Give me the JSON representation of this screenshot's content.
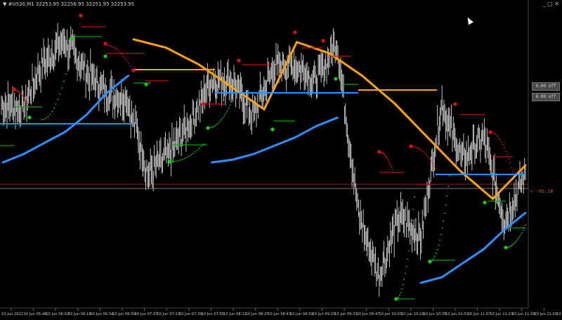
{
  "header": {
    "arrow": "▼",
    "symbol": "#US30,M1",
    "ohlc": "32253.95 32256.95 32251.95 32253.95",
    "window_controls": "_ □ ✕"
  },
  "badges": {
    "top": "0.00 off",
    "bottom": "0.00 off"
  },
  "countdown": "<--00:28",
  "colors": {
    "background": "#000000",
    "candles": "#d8d8d8",
    "ma_blue": "#2f8fff",
    "ma_orange": "#ffa20a",
    "sar_red": "#e01010",
    "sar_green": "#10d010",
    "level_red": "#c01010",
    "level_green": "#10a010",
    "price_line": "#8a2020",
    "gray_line": "#7a7a7a"
  },
  "chart_data": {
    "type": "line",
    "title": "#US30,M1",
    "xlabel": "",
    "ylabel": "",
    "grid": false,
    "x": [
      "10 Jun 2022",
      "10 Jun 05:46",
      "10 Jun 06:02",
      "10 Jun 06:18",
      "10 Jun 06:34",
      "10 Jun 06:50",
      "10 Jun 07:07",
      "10 Jun 07:23",
      "10 Jun 07:39",
      "10 Jun 07:55",
      "10 Jun 08:11",
      "10 Jun 08:27",
      "10 Jun 08:43",
      "10 Jun 08:59",
      "10 Jun 09:15",
      "10 Jun 09:31",
      "10 Jun 09:47",
      "10 Jun 10:03",
      "10 Jun 10:19",
      "10 Jun 10:35",
      "10 Jun 10:51",
      "10 Jun 11:07",
      "10 Jun 11:23",
      "10 Jun 11:39",
      "10 Jun 11:55",
      "10 Jun 12:11"
    ],
    "series": [
      {
        "values": [
          0.7,
          0.68,
          0.85,
          0.92,
          0.82,
          0.74,
          0.72,
          0.45,
          0.52,
          0.63,
          0.78,
          0.78,
          0.66,
          0.83,
          0.84,
          0.78,
          0.92,
          0.32,
          0.08,
          0.3,
          0.22,
          0.7,
          0.5,
          0.58,
          0.28,
          0.45
        ]
      },
      {
        "values": [
          0.49,
          0.52,
          0.56,
          0.6,
          0.66,
          0.74,
          0.8,
          null,
          null,
          null,
          0.49,
          0.5,
          0.52,
          0.55,
          0.58,
          0.62,
          0.65,
          null,
          null,
          null,
          0.06,
          0.08,
          0.13,
          0.18,
          0.25,
          0.31
        ]
      },
      {
        "values": [
          null,
          null,
          null,
          null,
          0.93,
          0.9,
          0.84,
          0.76,
          0.68,
          0.92,
          0.88,
          0.8,
          0.7,
          0.58,
          0.46,
          0.36,
          0.48
        ]
      }
    ]
  }
}
